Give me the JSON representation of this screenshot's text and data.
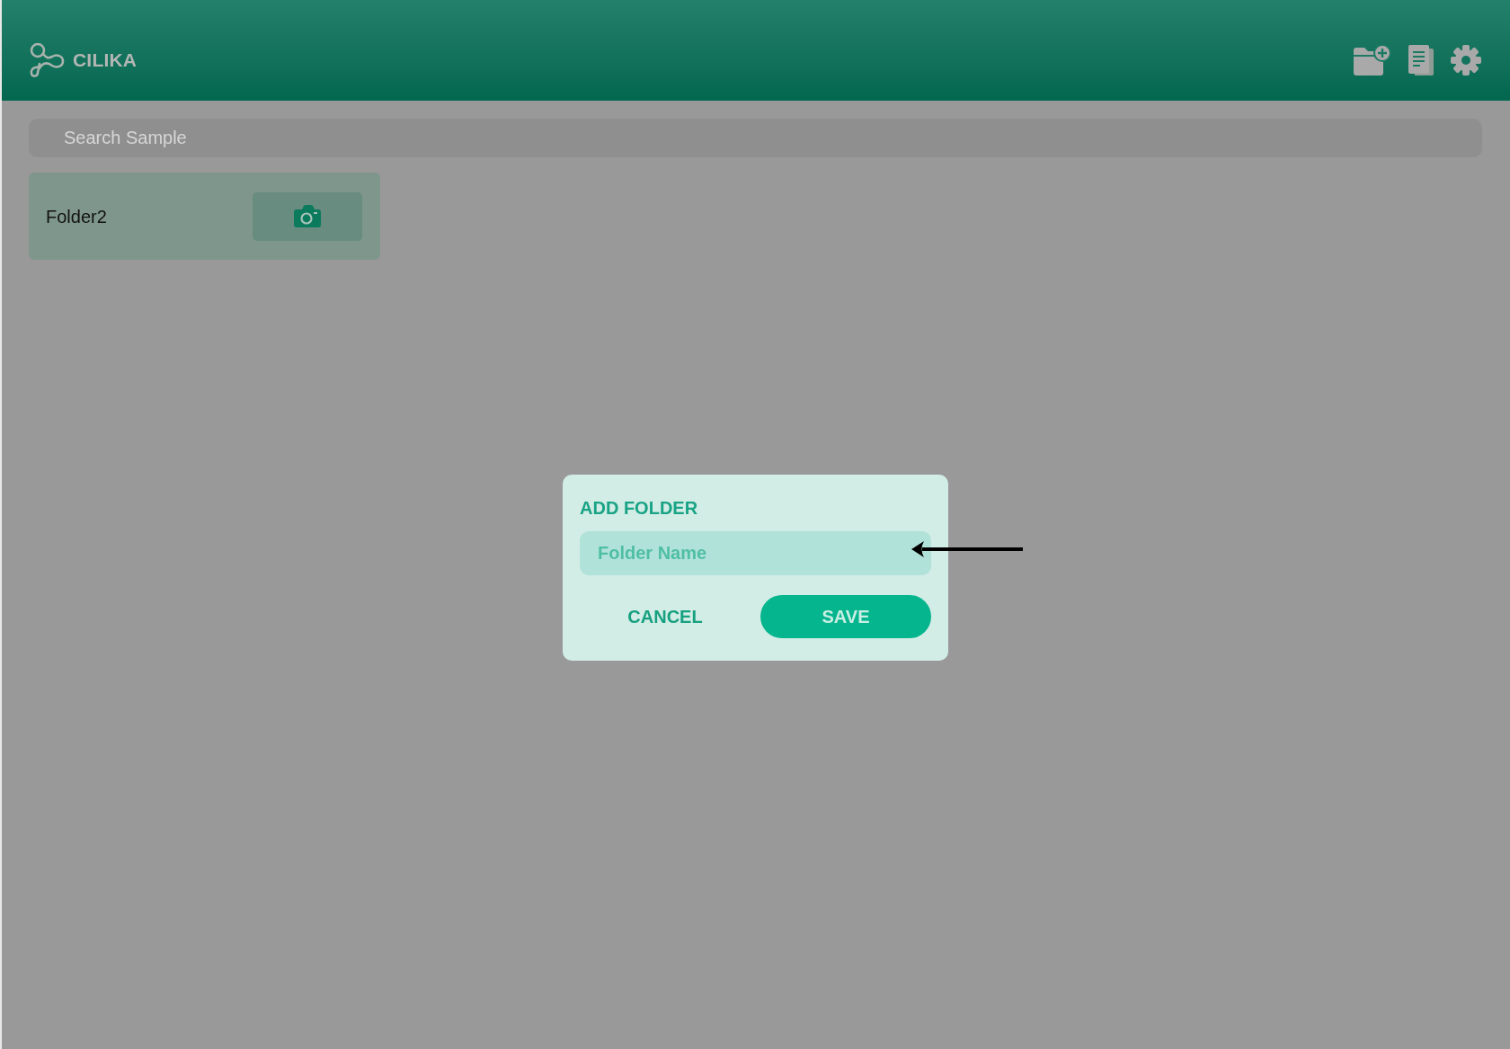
{
  "app_bar": {
    "title": "CILIKA"
  },
  "search": {
    "placeholder": "Search Sample"
  },
  "folders": [
    {
      "name": "Folder2"
    }
  ],
  "dialog": {
    "title": "ADD FOLDER",
    "field": {
      "placeholder": "Folder Name"
    },
    "buttons": [
      {
        "label": "CANCEL",
        "kind": "text"
      },
      {
        "label": "SAVE",
        "kind": "filled"
      }
    ]
  }
}
